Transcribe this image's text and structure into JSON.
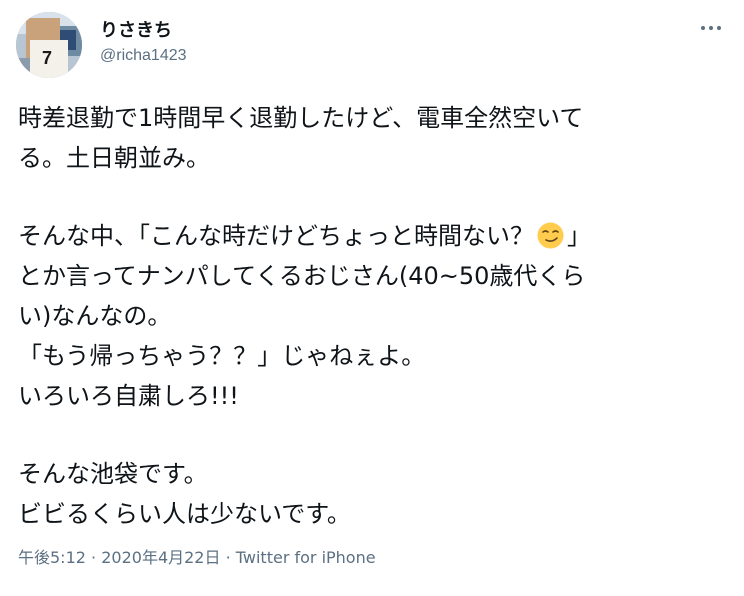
{
  "user": {
    "display_name": "りさきち",
    "handle": "@richa1423"
  },
  "tweet": {
    "line_1": "時差退勤で1時間早く退勤したけど、電車全然空いて",
    "line_2": "る。土日朝並み。",
    "line_3_before_emoji": "そんな中、「こんな時だけどちょっと時間ない？",
    "line_3_emoji": "smirking-face-emoji",
    "line_3_after_emoji": "」",
    "line_4": "とか言ってナンパしてくるおじさん(40~50歳代くら",
    "line_5": "い)なんなの。",
    "line_6": "「もう帰っちゃう？？」じゃねぇよ。",
    "line_7": "いろいろ自粛しろ!!!",
    "line_8": "そんな池袋です。",
    "line_9": "ビビるくらい人は少ないです。"
  },
  "meta": {
    "time": "午後5:12",
    "separator": "·",
    "date": "2020年4月22日",
    "source": "Twitter for iPhone"
  },
  "icons": {
    "more": "more-dots-icon",
    "emoji": "smirking-face-emoji"
  },
  "colors": {
    "text": "#0f1419",
    "secondary": "#5b7083",
    "emoji": "#ffcc4d"
  }
}
